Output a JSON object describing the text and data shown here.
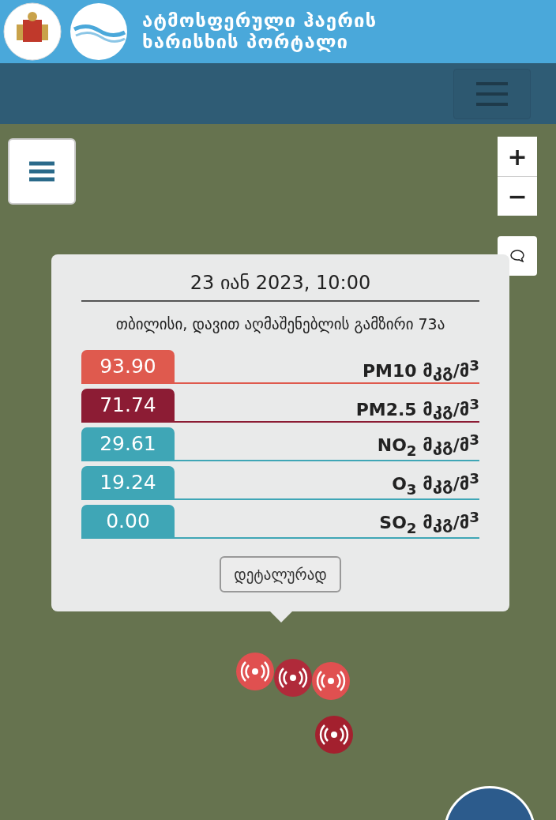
{
  "header": {
    "title_lines": [
      "ატმოსფერული ჰაერის",
      "ხარისხის პორტალი"
    ]
  },
  "map": {
    "zoom_in": "+",
    "zoom_out": "−",
    "markers": [
      {
        "color": "#e05050"
      },
      {
        "color": "#b02a3a"
      },
      {
        "color": "#e05050"
      },
      {
        "color": "#a3202e"
      }
    ],
    "popup": {
      "datetime": "23 იან 2023, 10:00",
      "address": "თბილისი, დავით აღმაშენებლის გამზირი 73ა",
      "readings": [
        {
          "value": "93.90",
          "label": "PM10 მკგ/მ$^{3}$",
          "color": "#df5a4e"
        },
        {
          "value": "71.74",
          "label": "PM2.5 მკგ/მ$^{3}$",
          "color": "#8c1c34"
        },
        {
          "value": "29.61",
          "label": "NO$_{2}$ მკგ/მ$^{3}$",
          "color": "#3fa6b6"
        },
        {
          "value": "19.24",
          "label": "O$_{3}$ მკგ/მ$^{3}$",
          "color": "#3fa6b6"
        },
        {
          "value": "0.00",
          "label": "SO$_{2}$ მკგ/მ$^{3}$",
          "color": "#3fa6b6"
        }
      ],
      "details_button": "დეტალურად"
    }
  }
}
